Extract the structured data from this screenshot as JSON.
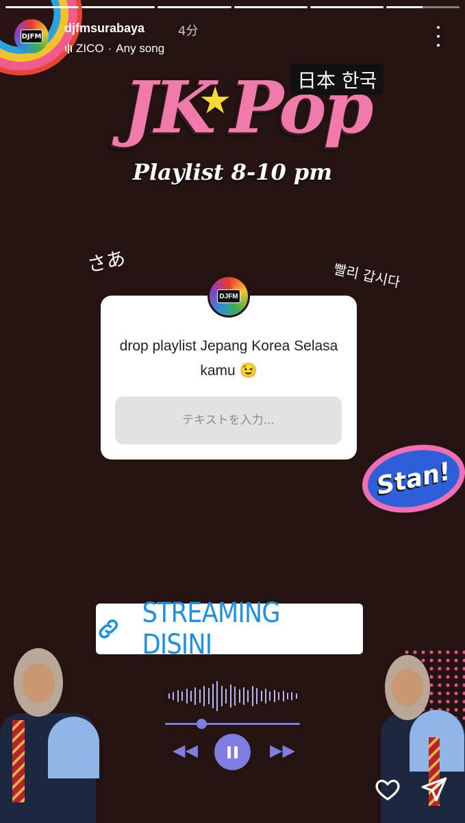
{
  "story": {
    "progress_segments": [
      1,
      1,
      1,
      1,
      1,
      0.5
    ],
    "username": "djfmsurabaya",
    "time_ago": "4分",
    "music": {
      "artist": "ZICO",
      "separator": "·",
      "title": "Any song"
    },
    "avatar_text": "DJFM"
  },
  "content": {
    "logo_main": "JK",
    "logo_star": "★",
    "logo_pop": "Pop",
    "logo_langs": "日本 한국",
    "subtitle": "Playlist 8-10 pm",
    "deco_jp": "さあ",
    "deco_kr": "빨리 갑시다",
    "question": {
      "avatar_text": "DJFM",
      "prompt": "drop playlist Jepang Korea Selasa kamu 😉",
      "placeholder": "テキストを入力..."
    },
    "sticker_stan": "Stan!",
    "link_sticker": {
      "label": "STREAMING DISINI",
      "icon": "link-icon"
    }
  },
  "player": {
    "progress": 0.27
  },
  "colors": {
    "background": "#251312",
    "accent_pink": "#f07aaa",
    "link_blue": "#1f8fe0",
    "player_purple": "#7e7ee0"
  }
}
